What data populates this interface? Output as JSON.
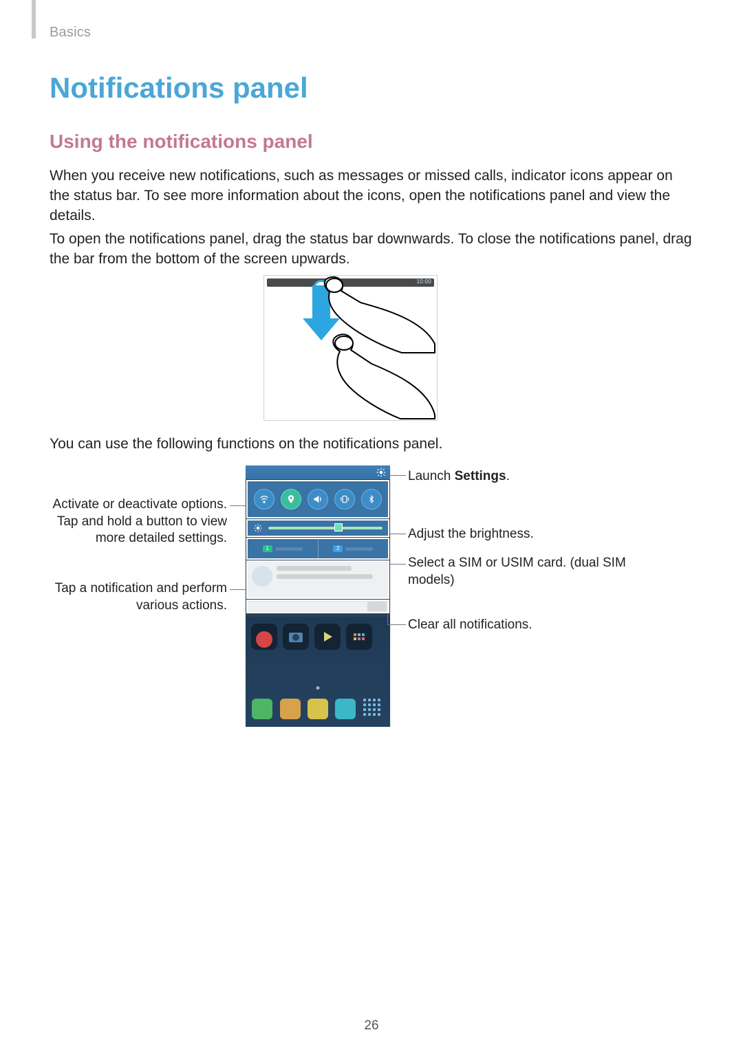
{
  "breadcrumb": "Basics",
  "page_title": "Notifications panel",
  "subheading": "Using the notifications panel",
  "paragraphs": {
    "p1": "When you receive new notifications, such as messages or missed calls, indicator icons appear on the status bar. To see more information about the icons, open the notifications panel and view the details.",
    "p2": "To open the notifications panel, drag the status bar downwards. To close the notifications panel, drag the bar from the bottom of the screen upwards.",
    "p3": "You can use the following functions on the notifications panel."
  },
  "figure_swipe": {
    "status_time": "10:00"
  },
  "figure_panel": {
    "sim1_num": "1",
    "sim2_num": "2"
  },
  "callouts": {
    "left_toggles": "Activate or deactivate options. Tap and hold a button to view more detailed settings.",
    "left_notif": "Tap a notification and perform various actions.",
    "right_settings_pre": "Launch ",
    "right_settings_bold": "Settings",
    "right_settings_post": ".",
    "right_brightness": "Adjust the brightness.",
    "right_sim": "Select a SIM or USIM card. (dual SIM models)",
    "right_clear": "Clear all notifications."
  },
  "page_number": "26"
}
